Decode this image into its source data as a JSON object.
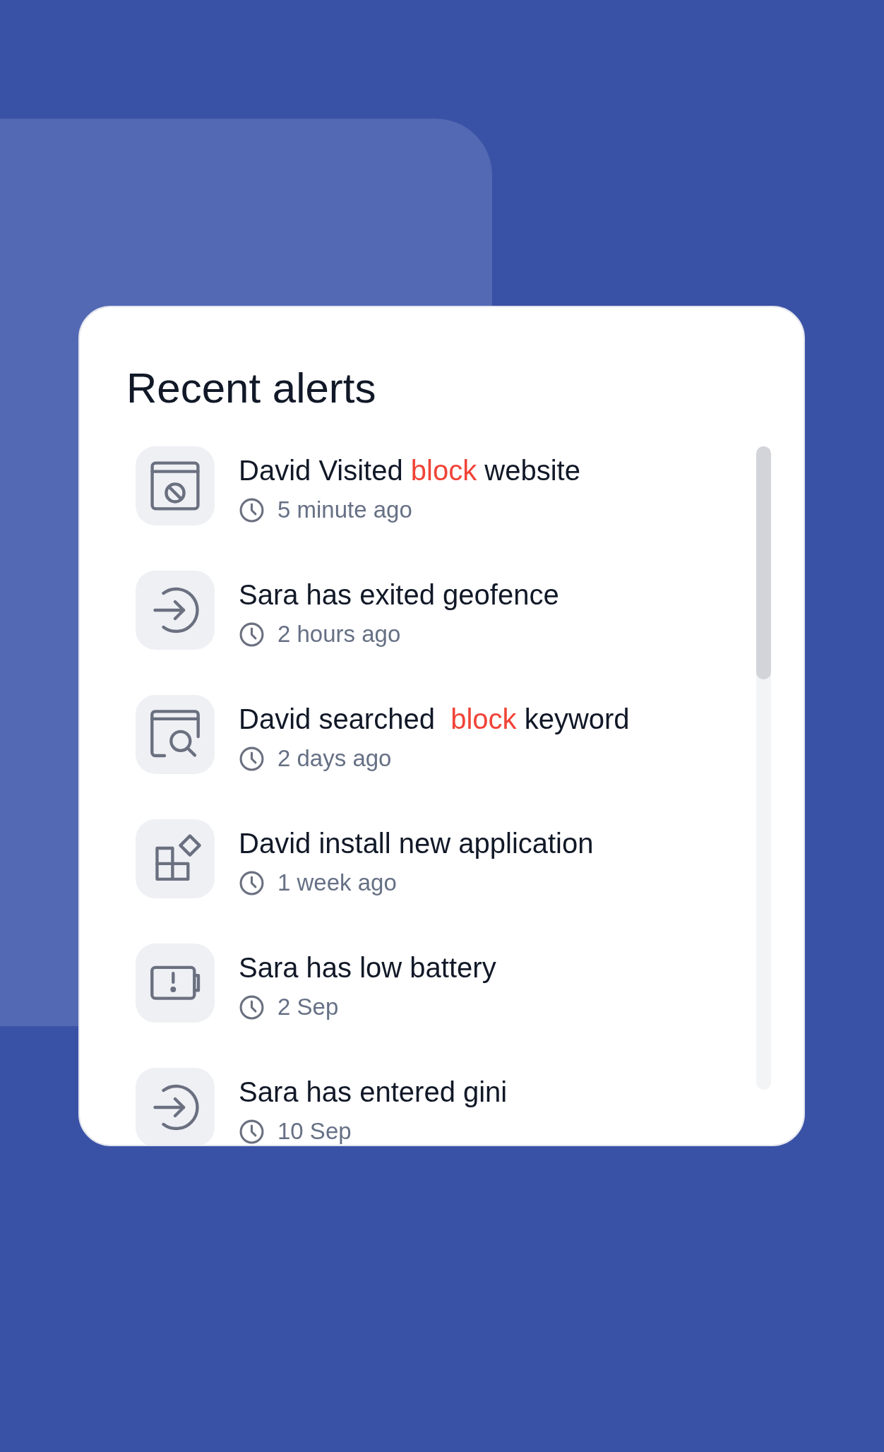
{
  "title": "Recent alerts",
  "alerts": [
    {
      "kind": "website",
      "title": [
        {
          "text": "David Visited ",
          "highlight": false
        },
        {
          "text": "block",
          "highlight": true
        },
        {
          "text": " website",
          "highlight": false
        }
      ],
      "time": "5 minute ago"
    },
    {
      "kind": "geofence",
      "title": [
        {
          "text": "Sara has exited geofence",
          "highlight": false
        }
      ],
      "time": "2 hours ago"
    },
    {
      "kind": "search",
      "title": [
        {
          "text": "David searched  ",
          "highlight": false
        },
        {
          "text": "block",
          "highlight": true
        },
        {
          "text": " keyword",
          "highlight": false
        }
      ],
      "time": "2 days ago"
    },
    {
      "kind": "app",
      "title": [
        {
          "text": "David install new application",
          "highlight": false
        }
      ],
      "time": "1 week ago"
    },
    {
      "kind": "battery",
      "title": [
        {
          "text": "Sara has low battery",
          "highlight": false
        }
      ],
      "time": "2 Sep"
    },
    {
      "kind": "geofence",
      "title": [
        {
          "text": "Sara has entered gini",
          "highlight": false
        }
      ],
      "time": "10 Sep"
    }
  ]
}
